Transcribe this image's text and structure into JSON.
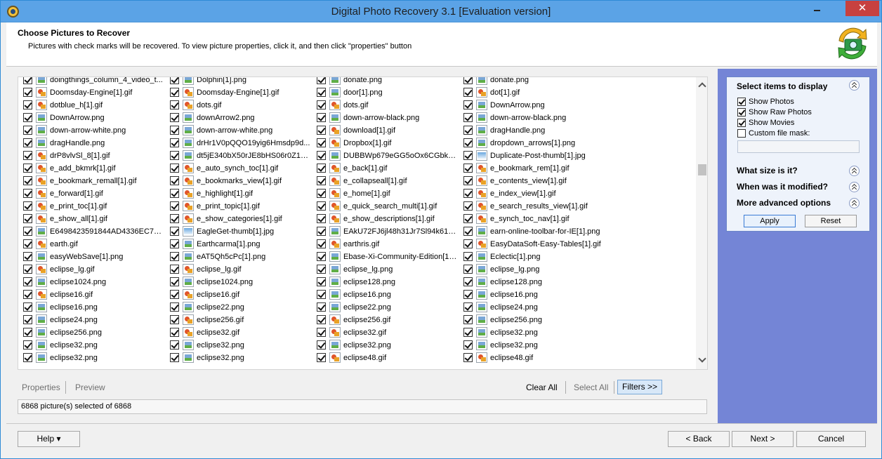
{
  "window": {
    "title": "Digital Photo Recovery 3.1 [Evaluation version]",
    "close_glyph": "✕"
  },
  "header": {
    "title": "Choose Pictures to Recover",
    "subtitle": "Pictures with check marks will be recovered. To view picture properties, click it, and then click \"properties\" button"
  },
  "files": [
    [
      "doingthings_column_4_video_t...",
      "Dolphin[1].png",
      "donate.png",
      "donate.png"
    ],
    [
      "Doomsday-Engine[1].gif",
      "Doomsday-Engine[1].gif",
      "door[1].png",
      "dot[1].gif"
    ],
    [
      "dotblue_h[1].gif",
      "dots.gif",
      "dots.gif",
      "DownArrow.png"
    ],
    [
      "DownArrow.png",
      "downArrow2.png",
      "down-arrow-black.png",
      "down-arrow-black.png"
    ],
    [
      "down-arrow-white.png",
      "down-arrow-white.png",
      "download[1].gif",
      "dragHandle.png"
    ],
    [
      "dragHandle.png",
      "drHr1V0pQQO19yig6Hmsdp9d...",
      "Dropbox[1].gif",
      "dropdown_arrows[1].png"
    ],
    [
      "drP8vlvSl_8[1].gif",
      "dt5jE340bX50rJE8bHS06r0Z18...",
      "DUBBWp679eGG5oOx6CGbkW6...",
      "Duplicate-Post-thumb[1].jpg"
    ],
    [
      "e_add_bkmrk[1].gif",
      "e_auto_synch_toc[1].gif",
      "e_back[1].gif",
      "e_bookmark_rem[1].gif"
    ],
    [
      "e_bookmark_remall[1].gif",
      "e_bookmarks_view[1].gif",
      "e_collapseall[1].gif",
      "e_contents_view[1].gif"
    ],
    [
      "e_forward[1].gif",
      "e_highlight[1].gif",
      "e_home[1].gif",
      "e_index_view[1].gif"
    ],
    [
      "e_print_toc[1].gif",
      "e_print_topic[1].gif",
      "e_quick_search_multi[1].gif",
      "e_search_results_view[1].gif"
    ],
    [
      "e_show_all[1].gif",
      "e_show_categories[1].gif",
      "e_show_descriptions[1].gif",
      "e_synch_toc_nav[1].gif"
    ],
    [
      "E6498423591844AD4336EC73B...",
      "EagleGet-thumb[1].jpg",
      "EAkU72FJ6jl48h31Jr7Sl94k618r...",
      "earn-online-toolbar-for-IE[1].png"
    ],
    [
      "earth.gif",
      "Earthcarma[1].png",
      "earthris.gif",
      "EasyDataSoft-Easy-Tables[1].gif"
    ],
    [
      "easyWebSave[1].png",
      "eAT5Qh5cPc[1].png",
      "Ebase-Xi-Community-Edition[1]...",
      "Eclectic[1].png"
    ],
    [
      "eclipse_lg.gif",
      "eclipse_lg.gif",
      "eclipse_lg.png",
      "eclipse_lg.png"
    ],
    [
      "eclipse1024.png",
      "eclipse1024.png",
      "eclipse128.png",
      "eclipse128.png"
    ],
    [
      "eclipse16.gif",
      "eclipse16.gif",
      "eclipse16.png",
      "eclipse16.png"
    ],
    [
      "eclipse16.png",
      "eclipse22.png",
      "eclipse22.png",
      "eclipse24.png"
    ],
    [
      "eclipse24.png",
      "eclipse256.gif",
      "eclipse256.gif",
      "eclipse256.png"
    ],
    [
      "eclipse256.png",
      "eclipse32.gif",
      "eclipse32.gif",
      "eclipse32.png"
    ],
    [
      "eclipse32.png",
      "eclipse32.png",
      "eclipse32.png",
      "eclipse32.png"
    ],
    [
      "eclipse32.png",
      "eclipse32.png",
      "eclipse48.gif",
      "eclipse48.gif"
    ]
  ],
  "actions": {
    "properties": "Properties",
    "preview": "Preview",
    "clear_all": "Clear All",
    "select_all": "Select All",
    "filters": "Filters >>"
  },
  "status": "6868 picture(s) selected of 6868",
  "filter_panel": {
    "select_items_title": "Select items to display",
    "options": [
      {
        "label": "Show Photos",
        "checked": true
      },
      {
        "label": "Show Raw Photos",
        "checked": true
      },
      {
        "label": "Show Movies",
        "checked": true
      },
      {
        "label": "Custom file mask:",
        "checked": false
      }
    ],
    "size_title": "What size is it?",
    "modified_title": "When was it modified?",
    "advanced_title": "More advanced options",
    "apply": "Apply",
    "reset": "Reset"
  },
  "footer": {
    "help": "Help ▾",
    "back": "< Back",
    "next": "Next >",
    "cancel": "Cancel"
  }
}
